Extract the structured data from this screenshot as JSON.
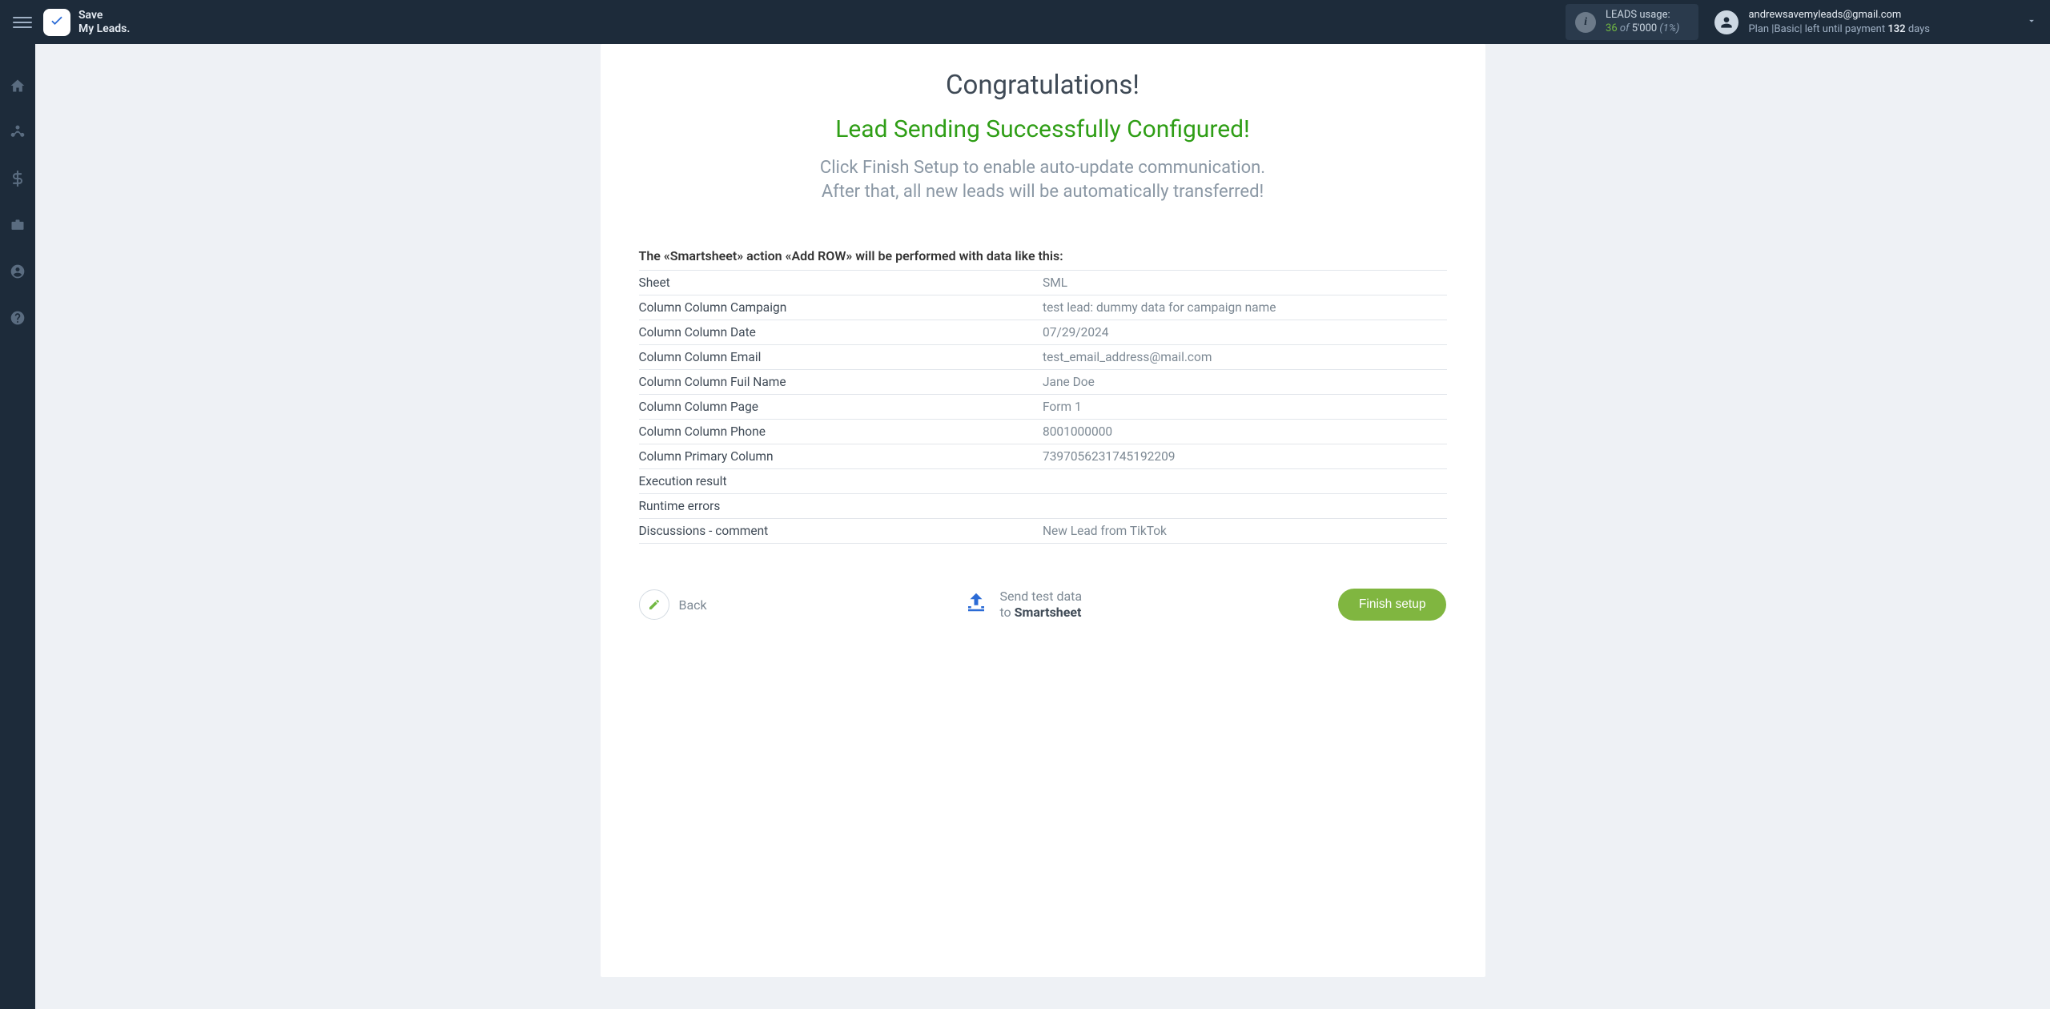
{
  "header": {
    "brand_line1": "Save",
    "brand_line2": "My Leads.",
    "usage": {
      "label": "LEADS usage:",
      "used": "36",
      "of_word": "of",
      "total": "5'000",
      "pct": "(1%)"
    },
    "account": {
      "email": "andrewsavemyleads@gmail.com",
      "plan_prefix": "Plan |",
      "plan_name": "Basic",
      "plan_mid": "| left until payment ",
      "days": "132",
      "days_word": " days"
    }
  },
  "main": {
    "congrats": "Congratulations!",
    "success": "Lead Sending Successfully Configured!",
    "instructions_line1": "Click Finish Setup to enable auto-update communication.",
    "instructions_line2": "After that, all new leads will be automatically transferred!",
    "action_title": "The «Smartsheet» action «Add ROW» will be performed with data like this:",
    "rows": [
      {
        "label": "Sheet",
        "value": "SML"
      },
      {
        "label": "Column Column Campaign",
        "value": "test lead: dummy data for campaign name"
      },
      {
        "label": "Column Column Date",
        "value": "07/29/2024"
      },
      {
        "label": "Column Column Email",
        "value": "test_email_address@mail.com"
      },
      {
        "label": "Column Column Fuil Name",
        "value": "Jane Doe"
      },
      {
        "label": "Column Column Page",
        "value": "Form 1"
      },
      {
        "label": "Column Column Phone",
        "value": "8001000000"
      },
      {
        "label": "Column Primary Column",
        "value": "7397056231745192209"
      },
      {
        "label": "Execution result",
        "value": ""
      },
      {
        "label": "Runtime errors",
        "value": ""
      },
      {
        "label": "Discussions - comment",
        "value": "New Lead from TikTok"
      }
    ],
    "buttons": {
      "back": "Back",
      "send_line1": "Send test data",
      "send_to": "to ",
      "send_service": "Smartsheet",
      "finish": "Finish setup"
    }
  }
}
